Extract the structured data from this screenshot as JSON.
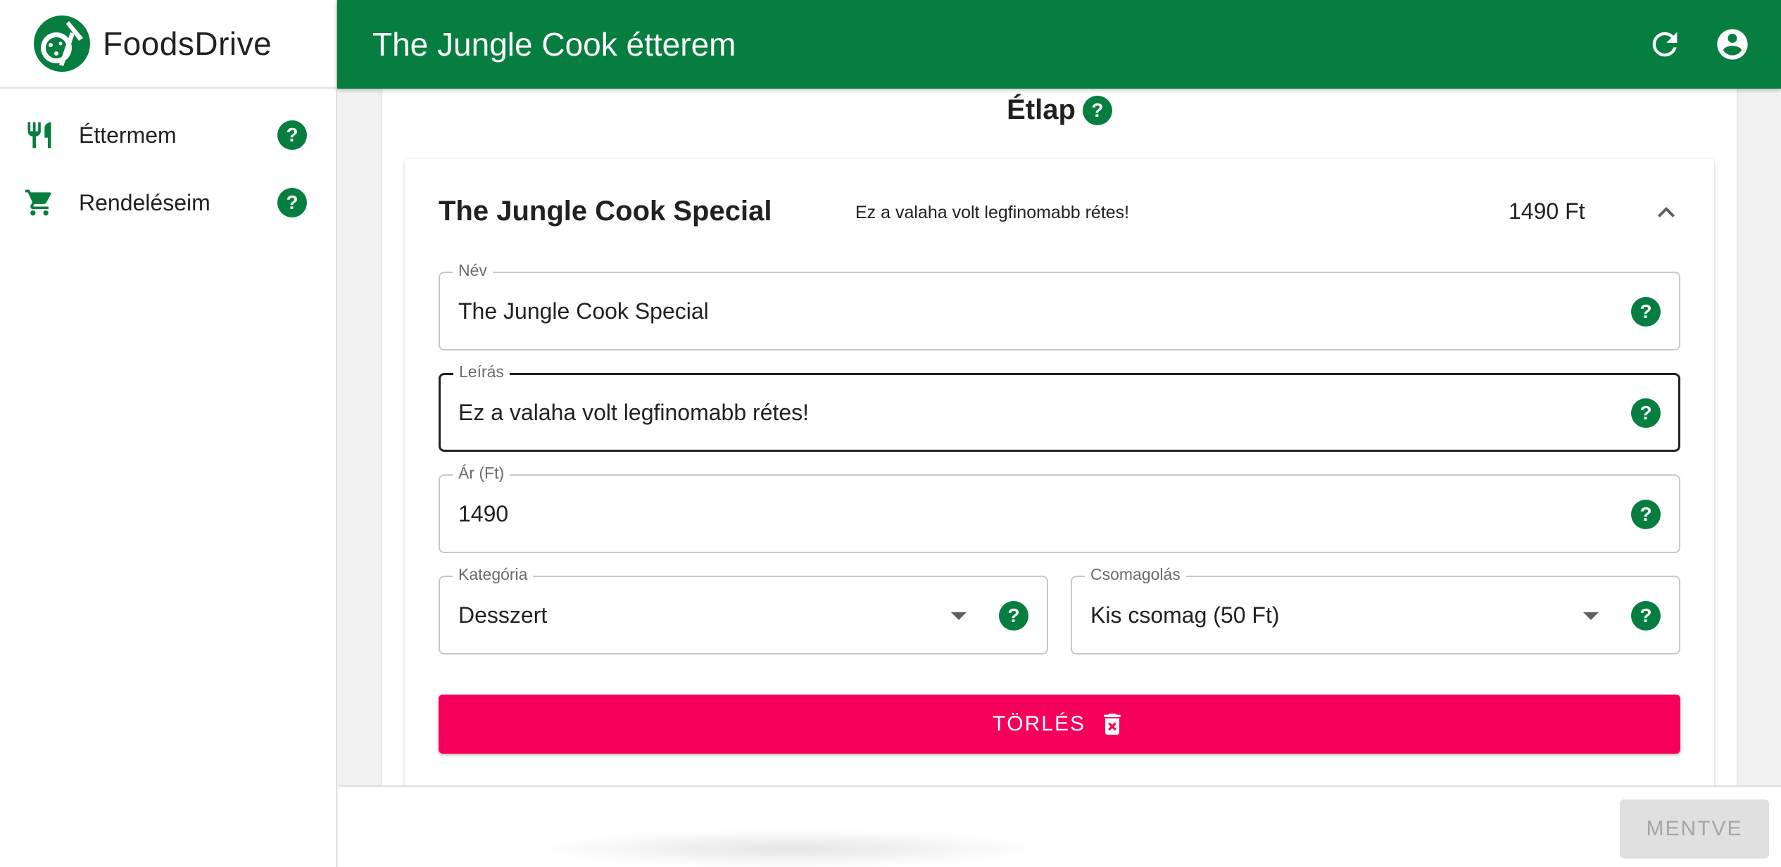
{
  "app": {
    "name": "FoodsDrive"
  },
  "sidebar": {
    "items": [
      {
        "label": "Éttermem",
        "icon": "cutlery-icon"
      },
      {
        "label": "Rendeléseim",
        "icon": "cart-icon"
      }
    ]
  },
  "header": {
    "title": "The Jungle Cook étterem"
  },
  "section": {
    "title": "Étlap"
  },
  "item": {
    "name": "The Jungle Cook Special",
    "description": "Ez a valaha volt legfinomabb rétes!",
    "price": "1490 Ft"
  },
  "form": {
    "name_label": "Név",
    "name_value": "The Jungle Cook Special",
    "desc_label": "Leírás",
    "desc_value": "Ez a valaha volt legfinomabb rétes!",
    "price_label": "Ár (Ft)",
    "price_value": "1490",
    "category_label": "Kategória",
    "category_value": "Desszert",
    "packaging_label": "Csomagolás",
    "packaging_value": "Kis csomag (50 Ft)"
  },
  "help_symbol": "?",
  "buttons": {
    "delete": "TÖRLÉS",
    "save": "MENTVE"
  },
  "colors": {
    "primary": "#067e3f",
    "danger": "#f5005a",
    "disabled": "#e0e0e0"
  }
}
